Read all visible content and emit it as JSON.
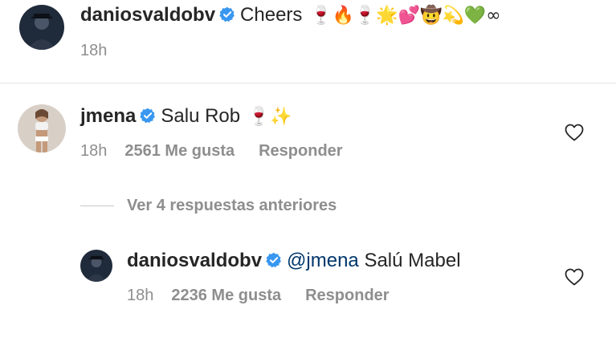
{
  "post_caption": {
    "username": "daniosvaldobv",
    "verified_icon": "verified-badge-icon",
    "text": "Cheers",
    "emojis": "🍷🔥🍷🌟💕🤠💫💚∞",
    "time": "18h"
  },
  "comment": {
    "username": "jmena",
    "verified_icon": "verified-badge-icon",
    "text": "Salu Rob",
    "emojis": "🍷✨",
    "time": "18h",
    "likes": "2561 Me gusta",
    "reply_label": "Responder",
    "like_icon": "heart-outline-icon"
  },
  "view_previous_replies": "Ver 4 respuestas anteriores",
  "reply": {
    "username": "daniosvaldobv",
    "verified_icon": "verified-badge-icon",
    "mention": "@jmena",
    "text": "Salú Mabel",
    "time": "18h",
    "likes": "2236 Me gusta",
    "reply_label": "Responder",
    "like_icon": "heart-outline-icon"
  },
  "colors": {
    "verified_blue": "#3897f0",
    "mention": "#00376b",
    "secondary_text": "#8e8e8e"
  }
}
